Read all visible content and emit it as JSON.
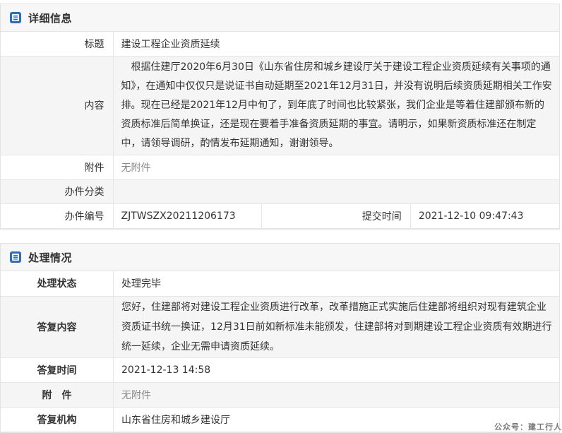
{
  "detail": {
    "title": "详细信息",
    "rows": {
      "subject_label": "标题",
      "subject_value": "建设工程企业资质延续",
      "content_label": "内容",
      "content_value": "根据住建厅2020年6月30日《山东省住房和城乡建设厅关于建设工程企业资质延续有关事项的通知》，在通知中仅仅只是说证书自动延期至2021年12月31日，并没有说明后续资质延期相关工作安排。现在已经是2021年12月中旬了，到年底了时间也比较紧张，我们企业是等着住建部颁布新的资质标准后简单换证，还是现在要着手准备资质延期的事宜。请明示，如果新资质标准还在制定中，请领导调研，酌情发布延期通知，谢谢领导。",
      "attachment_label": "附件",
      "attachment_value": "无附件",
      "category_label": "办件分类",
      "category_value": "",
      "number_label": "办件编号",
      "number_value": "ZJTWSZX20211206173",
      "submit_time_label": "提交时间",
      "submit_time_value": "2021-12-10 09:47:43"
    }
  },
  "handling": {
    "title": "处理情况",
    "rows": {
      "status_label": "处理状态",
      "status_value": "处理完毕",
      "reply_label": "答复内容",
      "reply_value": "您好，住建部将对建设工程企业资质进行改革，改革措施正式实施后住建部将组织对现有建筑企业资质证书统一换证，12月31日前如新标准未能颁发，住建部将对到期建设工程企业资质有效期进行统一延续，企业无需申请资质延续。",
      "reply_time_label": "答复时间",
      "reply_time_value": "2021-12-13 14:58",
      "attachment_label": "附　件",
      "attachment_value": "无附件",
      "org_label": "答复机构",
      "org_value": "山东省住房和城乡建设厅"
    }
  },
  "watermark": "公众号：建工行人",
  "icons": {
    "header": "document-list-icon"
  },
  "colors": {
    "icon_blue": "#2e6db4"
  }
}
